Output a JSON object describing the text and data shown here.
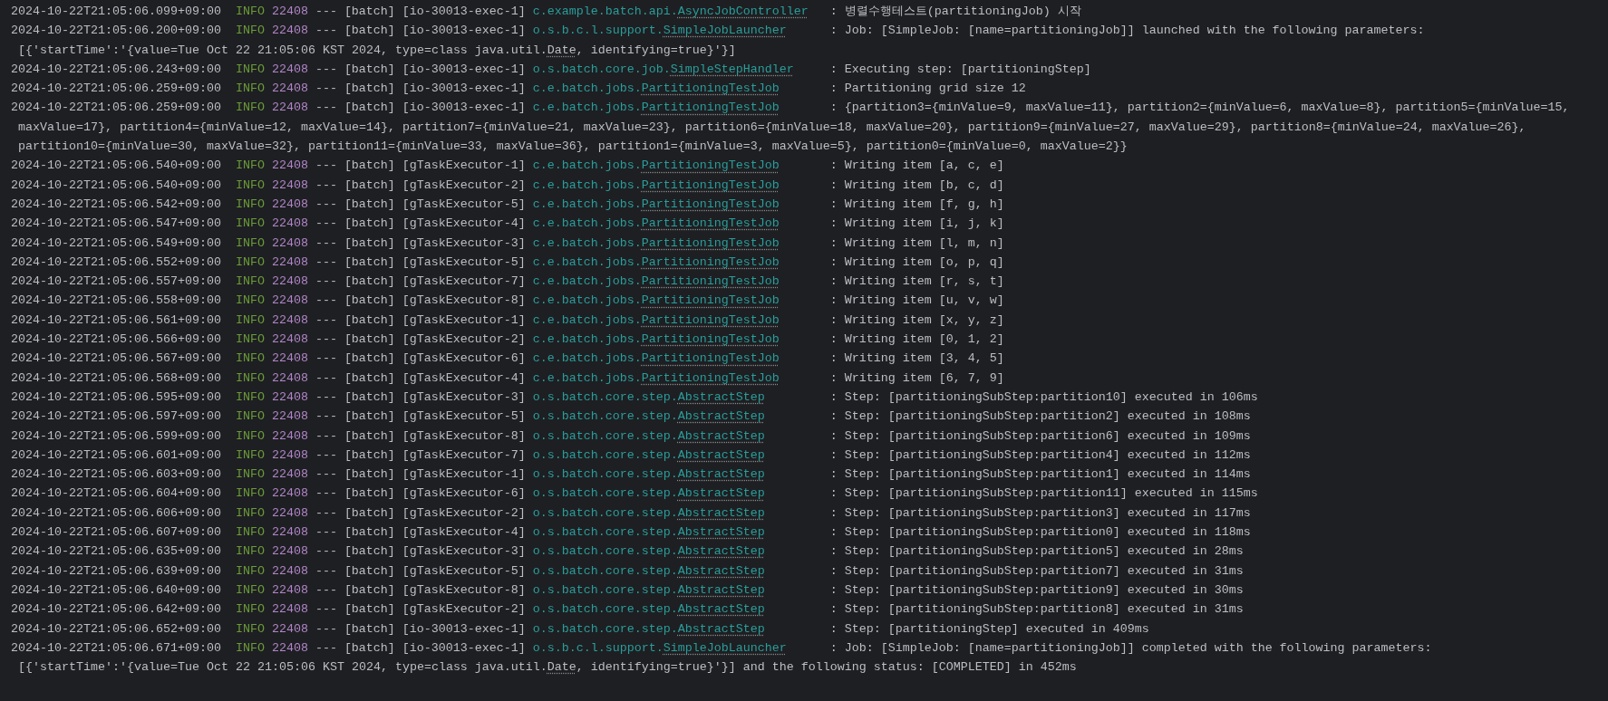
{
  "log_lines": [
    {
      "time": "2024-10-22T21:05:06.099+09:00",
      "level": "INFO",
      "pid": "22408",
      "sep": "---",
      "app": "[batch]",
      "thread": "[io-30013-exec-1]",
      "logger_package": "c.example.batch.api.",
      "logger_class": "AsyncJobController",
      "message": ": 병렬수행테스트(partitioningJob) 시작"
    },
    {
      "time": "2024-10-22T21:05:06.200+09:00",
      "level": "INFO",
      "pid": "22408",
      "sep": "---",
      "app": "[batch]",
      "thread": "[io-30013-exec-1]",
      "logger_package": "o.s.b.c.l.support.",
      "logger_class": "SimpleJobLauncher",
      "message": ": Job: [SimpleJob: [name=partitioningJob]] launched with the following parameters:",
      "continuation": [
        [
          {
            "text": "[{'startTime':'{value=Tue Oct 22 21:05:06 KST 2024, type=class java.util.",
            "link": false
          },
          {
            "text": "Date",
            "link": true
          },
          {
            "text": ", identifying=true}'}]",
            "link": false
          }
        ]
      ]
    },
    {
      "time": "2024-10-22T21:05:06.243+09:00",
      "level": "INFO",
      "pid": "22408",
      "sep": "---",
      "app": "[batch]",
      "thread": "[io-30013-exec-1]",
      "logger_package": "o.s.batch.core.job.",
      "logger_class": "SimpleStepHandler",
      "message": ": Executing step: [partitioningStep]"
    },
    {
      "time": "2024-10-22T21:05:06.259+09:00",
      "level": "INFO",
      "pid": "22408",
      "sep": "---",
      "app": "[batch]",
      "thread": "[io-30013-exec-1]",
      "logger_package": "c.e.batch.jobs.",
      "logger_class": "PartitioningTestJob",
      "message": ": Partitioning grid size 12"
    },
    {
      "time": "2024-10-22T21:05:06.259+09:00",
      "level": "INFO",
      "pid": "22408",
      "sep": "---",
      "app": "[batch]",
      "thread": "[io-30013-exec-1]",
      "logger_package": "c.e.batch.jobs.",
      "logger_class": "PartitioningTestJob",
      "message": ": {partition3={minValue=9, maxValue=11}, partition2={minValue=6, maxValue=8}, partition5={minValue=15,",
      "continuation": [
        [
          {
            "text": "maxValue=17}, partition4={minValue=12, maxValue=14}, partition7={minValue=21, maxValue=23}, partition6={minValue=18, maxValue=20}, partition9={minValue=27, maxValue=29}, partition8={minValue=24, maxValue=26},",
            "link": false
          }
        ],
        [
          {
            "text": "partition10={minValue=30, maxValue=32}, partition11={minValue=33, maxValue=36}, partition1={minValue=3, maxValue=5}, partition0={minValue=0, maxValue=2}}",
            "link": false
          }
        ]
      ]
    },
    {
      "time": "2024-10-22T21:05:06.540+09:00",
      "level": "INFO",
      "pid": "22408",
      "sep": "---",
      "app": "[batch]",
      "thread": "[gTaskExecutor-1]",
      "logger_package": "c.e.batch.jobs.",
      "logger_class": "PartitioningTestJob",
      "message": ": Writing item [a, c, e]"
    },
    {
      "time": "2024-10-22T21:05:06.540+09:00",
      "level": "INFO",
      "pid": "22408",
      "sep": "---",
      "app": "[batch]",
      "thread": "[gTaskExecutor-2]",
      "logger_package": "c.e.batch.jobs.",
      "logger_class": "PartitioningTestJob",
      "message": ": Writing item [b, c, d]"
    },
    {
      "time": "2024-10-22T21:05:06.542+09:00",
      "level": "INFO",
      "pid": "22408",
      "sep": "---",
      "app": "[batch]",
      "thread": "[gTaskExecutor-5]",
      "logger_package": "c.e.batch.jobs.",
      "logger_class": "PartitioningTestJob",
      "message": ": Writing item [f, g, h]"
    },
    {
      "time": "2024-10-22T21:05:06.547+09:00",
      "level": "INFO",
      "pid": "22408",
      "sep": "---",
      "app": "[batch]",
      "thread": "[gTaskExecutor-4]",
      "logger_package": "c.e.batch.jobs.",
      "logger_class": "PartitioningTestJob",
      "message": ": Writing item [i, j, k]"
    },
    {
      "time": "2024-10-22T21:05:06.549+09:00",
      "level": "INFO",
      "pid": "22408",
      "sep": "---",
      "app": "[batch]",
      "thread": "[gTaskExecutor-3]",
      "logger_package": "c.e.batch.jobs.",
      "logger_class": "PartitioningTestJob",
      "message": ": Writing item [l, m, n]"
    },
    {
      "time": "2024-10-22T21:05:06.552+09:00",
      "level": "INFO",
      "pid": "22408",
      "sep": "---",
      "app": "[batch]",
      "thread": "[gTaskExecutor-5]",
      "logger_package": "c.e.batch.jobs.",
      "logger_class": "PartitioningTestJob",
      "message": ": Writing item [o, p, q]"
    },
    {
      "time": "2024-10-22T21:05:06.557+09:00",
      "level": "INFO",
      "pid": "22408",
      "sep": "---",
      "app": "[batch]",
      "thread": "[gTaskExecutor-7]",
      "logger_package": "c.e.batch.jobs.",
      "logger_class": "PartitioningTestJob",
      "message": ": Writing item [r, s, t]"
    },
    {
      "time": "2024-10-22T21:05:06.558+09:00",
      "level": "INFO",
      "pid": "22408",
      "sep": "---",
      "app": "[batch]",
      "thread": "[gTaskExecutor-8]",
      "logger_package": "c.e.batch.jobs.",
      "logger_class": "PartitioningTestJob",
      "message": ": Writing item [u, v, w]"
    },
    {
      "time": "2024-10-22T21:05:06.561+09:00",
      "level": "INFO",
      "pid": "22408",
      "sep": "---",
      "app": "[batch]",
      "thread": "[gTaskExecutor-1]",
      "logger_package": "c.e.batch.jobs.",
      "logger_class": "PartitioningTestJob",
      "message": ": Writing item [x, y, z]"
    },
    {
      "time": "2024-10-22T21:05:06.566+09:00",
      "level": "INFO",
      "pid": "22408",
      "sep": "---",
      "app": "[batch]",
      "thread": "[gTaskExecutor-2]",
      "logger_package": "c.e.batch.jobs.",
      "logger_class": "PartitioningTestJob",
      "message": ": Writing item [0, 1, 2]"
    },
    {
      "time": "2024-10-22T21:05:06.567+09:00",
      "level": "INFO",
      "pid": "22408",
      "sep": "---",
      "app": "[batch]",
      "thread": "[gTaskExecutor-6]",
      "logger_package": "c.e.batch.jobs.",
      "logger_class": "PartitioningTestJob",
      "message": ": Writing item [3, 4, 5]"
    },
    {
      "time": "2024-10-22T21:05:06.568+09:00",
      "level": "INFO",
      "pid": "22408",
      "sep": "---",
      "app": "[batch]",
      "thread": "[gTaskExecutor-4]",
      "logger_package": "c.e.batch.jobs.",
      "logger_class": "PartitioningTestJob",
      "message": ": Writing item [6, 7, 9]"
    },
    {
      "time": "2024-10-22T21:05:06.595+09:00",
      "level": "INFO",
      "pid": "22408",
      "sep": "---",
      "app": "[batch]",
      "thread": "[gTaskExecutor-3]",
      "logger_package": "o.s.batch.core.step.",
      "logger_class": "AbstractStep",
      "message": ": Step: [partitioningSubStep:partition10] executed in 106ms"
    },
    {
      "time": "2024-10-22T21:05:06.597+09:00",
      "level": "INFO",
      "pid": "22408",
      "sep": "---",
      "app": "[batch]",
      "thread": "[gTaskExecutor-5]",
      "logger_package": "o.s.batch.core.step.",
      "logger_class": "AbstractStep",
      "message": ": Step: [partitioningSubStep:partition2] executed in 108ms"
    },
    {
      "time": "2024-10-22T21:05:06.599+09:00",
      "level": "INFO",
      "pid": "22408",
      "sep": "---",
      "app": "[batch]",
      "thread": "[gTaskExecutor-8]",
      "logger_package": "o.s.batch.core.step.",
      "logger_class": "AbstractStep",
      "message": ": Step: [partitioningSubStep:partition6] executed in 109ms"
    },
    {
      "time": "2024-10-22T21:05:06.601+09:00",
      "level": "INFO",
      "pid": "22408",
      "sep": "---",
      "app": "[batch]",
      "thread": "[gTaskExecutor-7]",
      "logger_package": "o.s.batch.core.step.",
      "logger_class": "AbstractStep",
      "message": ": Step: [partitioningSubStep:partition4] executed in 112ms"
    },
    {
      "time": "2024-10-22T21:05:06.603+09:00",
      "level": "INFO",
      "pid": "22408",
      "sep": "---",
      "app": "[batch]",
      "thread": "[gTaskExecutor-1]",
      "logger_package": "o.s.batch.core.step.",
      "logger_class": "AbstractStep",
      "message": ": Step: [partitioningSubStep:partition1] executed in 114ms"
    },
    {
      "time": "2024-10-22T21:05:06.604+09:00",
      "level": "INFO",
      "pid": "22408",
      "sep": "---",
      "app": "[batch]",
      "thread": "[gTaskExecutor-6]",
      "logger_package": "o.s.batch.core.step.",
      "logger_class": "AbstractStep",
      "message": ": Step: [partitioningSubStep:partition11] executed in 115ms"
    },
    {
      "time": "2024-10-22T21:05:06.606+09:00",
      "level": "INFO",
      "pid": "22408",
      "sep": "---",
      "app": "[batch]",
      "thread": "[gTaskExecutor-2]",
      "logger_package": "o.s.batch.core.step.",
      "logger_class": "AbstractStep",
      "message": ": Step: [partitioningSubStep:partition3] executed in 117ms"
    },
    {
      "time": "2024-10-22T21:05:06.607+09:00",
      "level": "INFO",
      "pid": "22408",
      "sep": "---",
      "app": "[batch]",
      "thread": "[gTaskExecutor-4]",
      "logger_package": "o.s.batch.core.step.",
      "logger_class": "AbstractStep",
      "message": ": Step: [partitioningSubStep:partition0] executed in 118ms"
    },
    {
      "time": "2024-10-22T21:05:06.635+09:00",
      "level": "INFO",
      "pid": "22408",
      "sep": "---",
      "app": "[batch]",
      "thread": "[gTaskExecutor-3]",
      "logger_package": "o.s.batch.core.step.",
      "logger_class": "AbstractStep",
      "message": ": Step: [partitioningSubStep:partition5] executed in 28ms"
    },
    {
      "time": "2024-10-22T21:05:06.639+09:00",
      "level": "INFO",
      "pid": "22408",
      "sep": "---",
      "app": "[batch]",
      "thread": "[gTaskExecutor-5]",
      "logger_package": "o.s.batch.core.step.",
      "logger_class": "AbstractStep",
      "message": ": Step: [partitioningSubStep:partition7] executed in 31ms"
    },
    {
      "time": "2024-10-22T21:05:06.640+09:00",
      "level": "INFO",
      "pid": "22408",
      "sep": "---",
      "app": "[batch]",
      "thread": "[gTaskExecutor-8]",
      "logger_package": "o.s.batch.core.step.",
      "logger_class": "AbstractStep",
      "message": ": Step: [partitioningSubStep:partition9] executed in 30ms"
    },
    {
      "time": "2024-10-22T21:05:06.642+09:00",
      "level": "INFO",
      "pid": "22408",
      "sep": "---",
      "app": "[batch]",
      "thread": "[gTaskExecutor-2]",
      "logger_package": "o.s.batch.core.step.",
      "logger_class": "AbstractStep",
      "message": ": Step: [partitioningSubStep:partition8] executed in 31ms"
    },
    {
      "time": "2024-10-22T21:05:06.652+09:00",
      "level": "INFO",
      "pid": "22408",
      "sep": "---",
      "app": "[batch]",
      "thread": "[io-30013-exec-1]",
      "logger_package": "o.s.batch.core.step.",
      "logger_class": "AbstractStep",
      "message": ": Step: [partitioningStep] executed in 409ms"
    },
    {
      "time": "2024-10-22T21:05:06.671+09:00",
      "level": "INFO",
      "pid": "22408",
      "sep": "---",
      "app": "[batch]",
      "thread": "[io-30013-exec-1]",
      "logger_package": "o.s.b.c.l.support.",
      "logger_class": "SimpleJobLauncher",
      "message": ": Job: [SimpleJob: [name=partitioningJob]] completed with the following parameters:",
      "continuation": [
        [
          {
            "text": "[{'startTime':'{value=Tue Oct 22 21:05:06 KST 2024, type=class java.util.",
            "link": false
          },
          {
            "text": "Date",
            "link": true
          },
          {
            "text": ", identifying=true}'}] and the following status: [COMPLETED] in 452ms",
            "link": false
          }
        ]
      ]
    }
  ]
}
